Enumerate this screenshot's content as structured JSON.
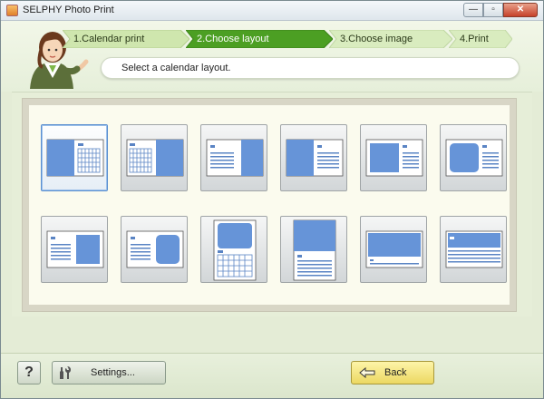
{
  "window": {
    "title": "SELPHY Photo Print",
    "controls": {
      "minimize": "—",
      "maximize": "▫",
      "close": "✕"
    }
  },
  "steps": [
    {
      "label": "1.Calendar print",
      "state": "done"
    },
    {
      "label": "2.Choose layout",
      "state": "active"
    },
    {
      "label": "3.Choose image",
      "state": "upcoming"
    },
    {
      "label": "4.Print",
      "state": "upcoming"
    }
  ],
  "instruction": "Select a calendar layout.",
  "layouts": [
    {
      "id": "layout-1",
      "orientation": "landscape",
      "photo": "left-half",
      "selected": true
    },
    {
      "id": "layout-2",
      "orientation": "landscape",
      "photo": "right-half",
      "selected": false
    },
    {
      "id": "layout-3",
      "orientation": "landscape",
      "photo": "right-half-small-cal",
      "selected": false
    },
    {
      "id": "layout-4",
      "orientation": "landscape",
      "photo": "left-half-small-cal",
      "selected": false
    },
    {
      "id": "layout-5",
      "orientation": "landscape",
      "photo": "left-box",
      "selected": false
    },
    {
      "id": "layout-6",
      "orientation": "landscape",
      "photo": "left-rounded",
      "selected": false
    },
    {
      "id": "layout-7",
      "orientation": "landscape",
      "photo": "right-box-with-cal-left",
      "selected": false
    },
    {
      "id": "layout-8",
      "orientation": "landscape",
      "photo": "right-rounded-with-cal-left",
      "selected": false
    },
    {
      "id": "layout-9",
      "orientation": "portrait",
      "photo": "top-rounded",
      "selected": false
    },
    {
      "id": "layout-10",
      "orientation": "portrait",
      "photo": "top-full",
      "selected": false
    },
    {
      "id": "layout-11",
      "orientation": "landscape",
      "photo": "top-wide",
      "selected": false
    },
    {
      "id": "layout-12",
      "orientation": "landscape",
      "photo": "band-with-strip-cal",
      "selected": false
    }
  ],
  "footer": {
    "help_label": "?",
    "settings_label": "Settings...",
    "back_label": "Back"
  },
  "colors": {
    "step_done": "#c9e4a6",
    "step_active": "#4ca024",
    "photo_blue": "#6694d8",
    "calendar_dot": "#5a84c4",
    "back_button": "#f3e27a"
  }
}
